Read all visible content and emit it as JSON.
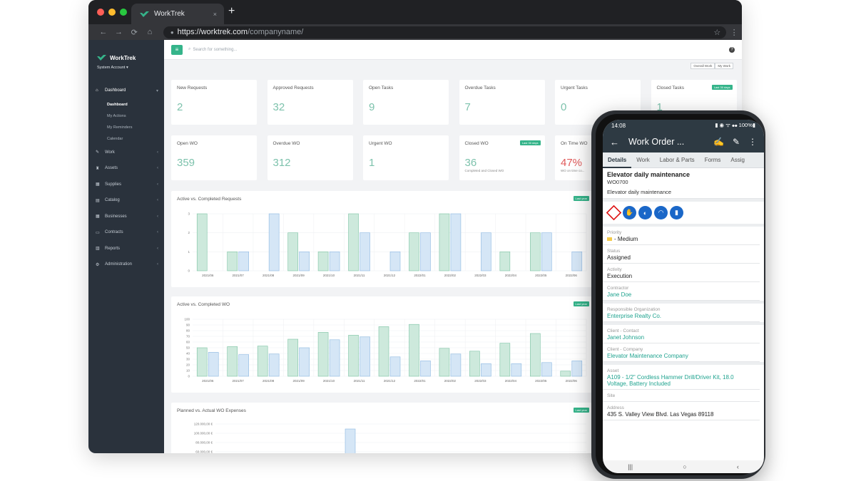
{
  "browser": {
    "tab_title": "WorkTrek",
    "tab_close": "×",
    "new_tab": "+",
    "url_host": "https://worktrek.com",
    "url_path": "/companyname/",
    "nav_back": "←",
    "nav_forward": "→",
    "nav_reload": "⟳",
    "nav_home": "⌂",
    "star": "☆",
    "menu": "⋮"
  },
  "sidebar": {
    "brand": "WorkTrek",
    "account": "System Account ▾",
    "items": [
      {
        "label": "Dashboard",
        "icon": "home-icon",
        "glyph": "⌂",
        "active": true
      },
      {
        "label": "Work",
        "icon": "wrench-icon",
        "glyph": "✎"
      },
      {
        "label": "Assets",
        "icon": "assets-icon",
        "glyph": "♜"
      },
      {
        "label": "Supplies",
        "icon": "supplies-icon",
        "glyph": "▦"
      },
      {
        "label": "Catalog",
        "icon": "catalog-icon",
        "glyph": "▤"
      },
      {
        "label": "Businesses",
        "icon": "business-icon",
        "glyph": "▦"
      },
      {
        "label": "Contracts",
        "icon": "contract-icon",
        "glyph": "▭"
      },
      {
        "label": "Reports",
        "icon": "reports-icon",
        "glyph": "▥"
      },
      {
        "label": "Administration",
        "icon": "admin-icon",
        "glyph": "⚙"
      }
    ],
    "sub_items": [
      "Dashboard",
      "My Actions",
      "My Reminders",
      "Calendar"
    ]
  },
  "topbar": {
    "search_placeholder": "Search for something...",
    "help": "?",
    "view_overall": "Overall Work",
    "view_mine": "My Work"
  },
  "stat_cards_row1": [
    {
      "label": "New Requests",
      "value": "2"
    },
    {
      "label": "Approved Requests",
      "value": "32"
    },
    {
      "label": "Open Tasks",
      "value": "9"
    },
    {
      "label": "Overdue Tasks",
      "value": "7"
    },
    {
      "label": "Urgent Tasks",
      "value": "0"
    },
    {
      "label": "Closed Tasks",
      "value": "1",
      "badge": "Last 30 days"
    }
  ],
  "stat_cards_row2": [
    {
      "label": "Open WO",
      "value": "359"
    },
    {
      "label": "Overdue WO",
      "value": "312"
    },
    {
      "label": "Urgent WO",
      "value": "1"
    },
    {
      "label": "Closed WO",
      "value": "36",
      "badge": "Last 30 days",
      "note": "Completed and Closed WO"
    },
    {
      "label": "On Time WO",
      "value": "47%",
      "note": "WO on time co..."
    }
  ],
  "chart_data": [
    {
      "type": "bar",
      "title": "Active vs. Completed Requests",
      "badge": "Last year",
      "categories": [
        "2021/06",
        "2021/07",
        "2021/08",
        "2021/09",
        "2021/10",
        "2021/11",
        "2021/12",
        "2022/01",
        "2022/02",
        "2022/03",
        "2022/04",
        "2022/05",
        "2022/06"
      ],
      "series": [
        {
          "values": [
            3,
            1,
            0,
            2,
            1,
            3,
            0,
            2,
            3,
            0,
            1,
            2,
            0
          ],
          "color": "#cde9dc"
        },
        {
          "values": [
            0,
            1,
            3,
            1,
            1,
            2,
            1,
            2,
            3,
            2,
            0,
            2,
            1
          ],
          "color": "#d5e6f6"
        }
      ],
      "ylim": [
        0,
        3
      ],
      "yticks": [
        "0",
        "1",
        "2",
        "3"
      ]
    },
    {
      "type": "bar",
      "title": "Active vs. Completed WO",
      "badge": "Last year",
      "categories": [
        "2021/06",
        "2021/07",
        "2021/08",
        "2021/09",
        "2021/10",
        "2021/11",
        "2021/12",
        "2022/01",
        "2022/02",
        "2022/03",
        "2022/04",
        "2022/05",
        "2022/06"
      ],
      "series": [
        {
          "values": [
            50,
            52,
            53,
            65,
            77,
            72,
            87,
            91,
            49,
            44,
            58,
            75,
            9
          ],
          "color": "#cde9dc"
        },
        {
          "values": [
            42,
            38,
            39,
            50,
            64,
            69,
            34,
            27,
            39,
            22,
            22,
            24,
            27
          ],
          "color": "#d5e6f6"
        }
      ],
      "ylim": [
        0,
        100
      ],
      "yticks": [
        "0",
        "10",
        "20",
        "30",
        "40",
        "50",
        "60",
        "70",
        "80",
        "90",
        "100"
      ]
    },
    {
      "type": "bar",
      "title": "Planned vs. Actual WO Expenses",
      "badge": "Last year",
      "yticks": [
        "120.000,00 €",
        "100.000,00 €",
        "80.000,00 €",
        "60.000,00 €"
      ]
    }
  ],
  "phone": {
    "time": "14:08",
    "status_right": "▮ ◉ ᯤ ⦁⦁ 100%▮",
    "title": "Work Order ...",
    "tabs": [
      "Details",
      "Work",
      "Labor & Parts",
      "Forms",
      "Assig"
    ],
    "wo_title": "Elevator daily maintenance",
    "wo_number": "WO0700",
    "wo_desc": "Elevator daily maintenance",
    "fields": [
      {
        "key": "Priority",
        "value": "- Medium",
        "priority": true
      },
      {
        "key": "Status",
        "value": "Assigned"
      },
      {
        "key": "Activity",
        "value": "Execution"
      },
      {
        "key": "Contractor",
        "value": "Jane Doe",
        "link": true
      },
      {
        "key": "Responsible Organization",
        "value": "Enterprise Realty Co.",
        "link": true
      },
      {
        "key": "Client - Contact",
        "value": "Janet Johnson",
        "link": true
      },
      {
        "key": "Client - Company",
        "value": "Elevator Maintenance Company",
        "link": true
      },
      {
        "key": "Asset",
        "value": "A109 - 1/2\" Cordless Hammer Drill/Driver Kit, 18.0 Voltage, Battery Included",
        "link": true
      },
      {
        "key": "Site",
        "value": ""
      },
      {
        "key": "Address",
        "value": "435 S. Valley View Blvd. Las Vegas 89118"
      }
    ]
  }
}
